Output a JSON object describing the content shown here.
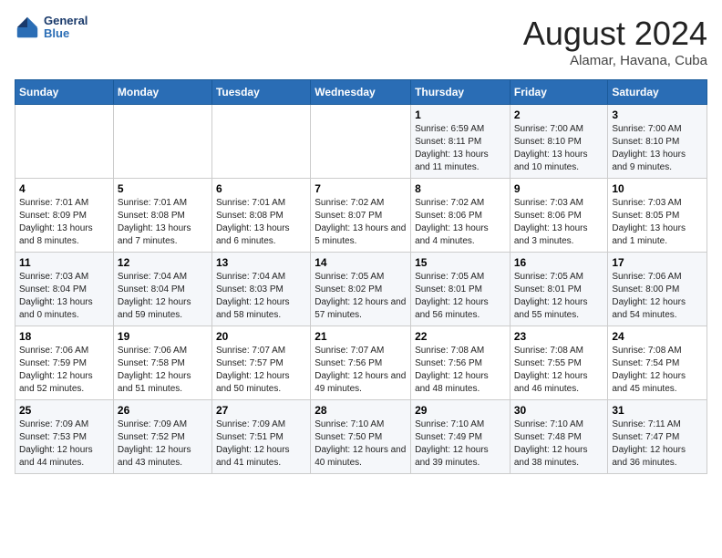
{
  "header": {
    "logo_line1": "General",
    "logo_line2": "Blue",
    "title": "August 2024",
    "subtitle": "Alamar, Havana, Cuba"
  },
  "days_of_week": [
    "Sunday",
    "Monday",
    "Tuesday",
    "Wednesday",
    "Thursday",
    "Friday",
    "Saturday"
  ],
  "weeks": [
    [
      {
        "day": "",
        "info": ""
      },
      {
        "day": "",
        "info": ""
      },
      {
        "day": "",
        "info": ""
      },
      {
        "day": "",
        "info": ""
      },
      {
        "day": "1",
        "info": "Sunrise: 6:59 AM\nSunset: 8:11 PM\nDaylight: 13 hours and 11 minutes."
      },
      {
        "day": "2",
        "info": "Sunrise: 7:00 AM\nSunset: 8:10 PM\nDaylight: 13 hours and 10 minutes."
      },
      {
        "day": "3",
        "info": "Sunrise: 7:00 AM\nSunset: 8:10 PM\nDaylight: 13 hours and 9 minutes."
      }
    ],
    [
      {
        "day": "4",
        "info": "Sunrise: 7:01 AM\nSunset: 8:09 PM\nDaylight: 13 hours and 8 minutes."
      },
      {
        "day": "5",
        "info": "Sunrise: 7:01 AM\nSunset: 8:08 PM\nDaylight: 13 hours and 7 minutes."
      },
      {
        "day": "6",
        "info": "Sunrise: 7:01 AM\nSunset: 8:08 PM\nDaylight: 13 hours and 6 minutes."
      },
      {
        "day": "7",
        "info": "Sunrise: 7:02 AM\nSunset: 8:07 PM\nDaylight: 13 hours and 5 minutes."
      },
      {
        "day": "8",
        "info": "Sunrise: 7:02 AM\nSunset: 8:06 PM\nDaylight: 13 hours and 4 minutes."
      },
      {
        "day": "9",
        "info": "Sunrise: 7:03 AM\nSunset: 8:06 PM\nDaylight: 13 hours and 3 minutes."
      },
      {
        "day": "10",
        "info": "Sunrise: 7:03 AM\nSunset: 8:05 PM\nDaylight: 13 hours and 1 minute."
      }
    ],
    [
      {
        "day": "11",
        "info": "Sunrise: 7:03 AM\nSunset: 8:04 PM\nDaylight: 13 hours and 0 minutes."
      },
      {
        "day": "12",
        "info": "Sunrise: 7:04 AM\nSunset: 8:04 PM\nDaylight: 12 hours and 59 minutes."
      },
      {
        "day": "13",
        "info": "Sunrise: 7:04 AM\nSunset: 8:03 PM\nDaylight: 12 hours and 58 minutes."
      },
      {
        "day": "14",
        "info": "Sunrise: 7:05 AM\nSunset: 8:02 PM\nDaylight: 12 hours and 57 minutes."
      },
      {
        "day": "15",
        "info": "Sunrise: 7:05 AM\nSunset: 8:01 PM\nDaylight: 12 hours and 56 minutes."
      },
      {
        "day": "16",
        "info": "Sunrise: 7:05 AM\nSunset: 8:01 PM\nDaylight: 12 hours and 55 minutes."
      },
      {
        "day": "17",
        "info": "Sunrise: 7:06 AM\nSunset: 8:00 PM\nDaylight: 12 hours and 54 minutes."
      }
    ],
    [
      {
        "day": "18",
        "info": "Sunrise: 7:06 AM\nSunset: 7:59 PM\nDaylight: 12 hours and 52 minutes."
      },
      {
        "day": "19",
        "info": "Sunrise: 7:06 AM\nSunset: 7:58 PM\nDaylight: 12 hours and 51 minutes."
      },
      {
        "day": "20",
        "info": "Sunrise: 7:07 AM\nSunset: 7:57 PM\nDaylight: 12 hours and 50 minutes."
      },
      {
        "day": "21",
        "info": "Sunrise: 7:07 AM\nSunset: 7:56 PM\nDaylight: 12 hours and 49 minutes."
      },
      {
        "day": "22",
        "info": "Sunrise: 7:08 AM\nSunset: 7:56 PM\nDaylight: 12 hours and 48 minutes."
      },
      {
        "day": "23",
        "info": "Sunrise: 7:08 AM\nSunset: 7:55 PM\nDaylight: 12 hours and 46 minutes."
      },
      {
        "day": "24",
        "info": "Sunrise: 7:08 AM\nSunset: 7:54 PM\nDaylight: 12 hours and 45 minutes."
      }
    ],
    [
      {
        "day": "25",
        "info": "Sunrise: 7:09 AM\nSunset: 7:53 PM\nDaylight: 12 hours and 44 minutes."
      },
      {
        "day": "26",
        "info": "Sunrise: 7:09 AM\nSunset: 7:52 PM\nDaylight: 12 hours and 43 minutes."
      },
      {
        "day": "27",
        "info": "Sunrise: 7:09 AM\nSunset: 7:51 PM\nDaylight: 12 hours and 41 minutes."
      },
      {
        "day": "28",
        "info": "Sunrise: 7:10 AM\nSunset: 7:50 PM\nDaylight: 12 hours and 40 minutes."
      },
      {
        "day": "29",
        "info": "Sunrise: 7:10 AM\nSunset: 7:49 PM\nDaylight: 12 hours and 39 minutes."
      },
      {
        "day": "30",
        "info": "Sunrise: 7:10 AM\nSunset: 7:48 PM\nDaylight: 12 hours and 38 minutes."
      },
      {
        "day": "31",
        "info": "Sunrise: 7:11 AM\nSunset: 7:47 PM\nDaylight: 12 hours and 36 minutes."
      }
    ]
  ]
}
